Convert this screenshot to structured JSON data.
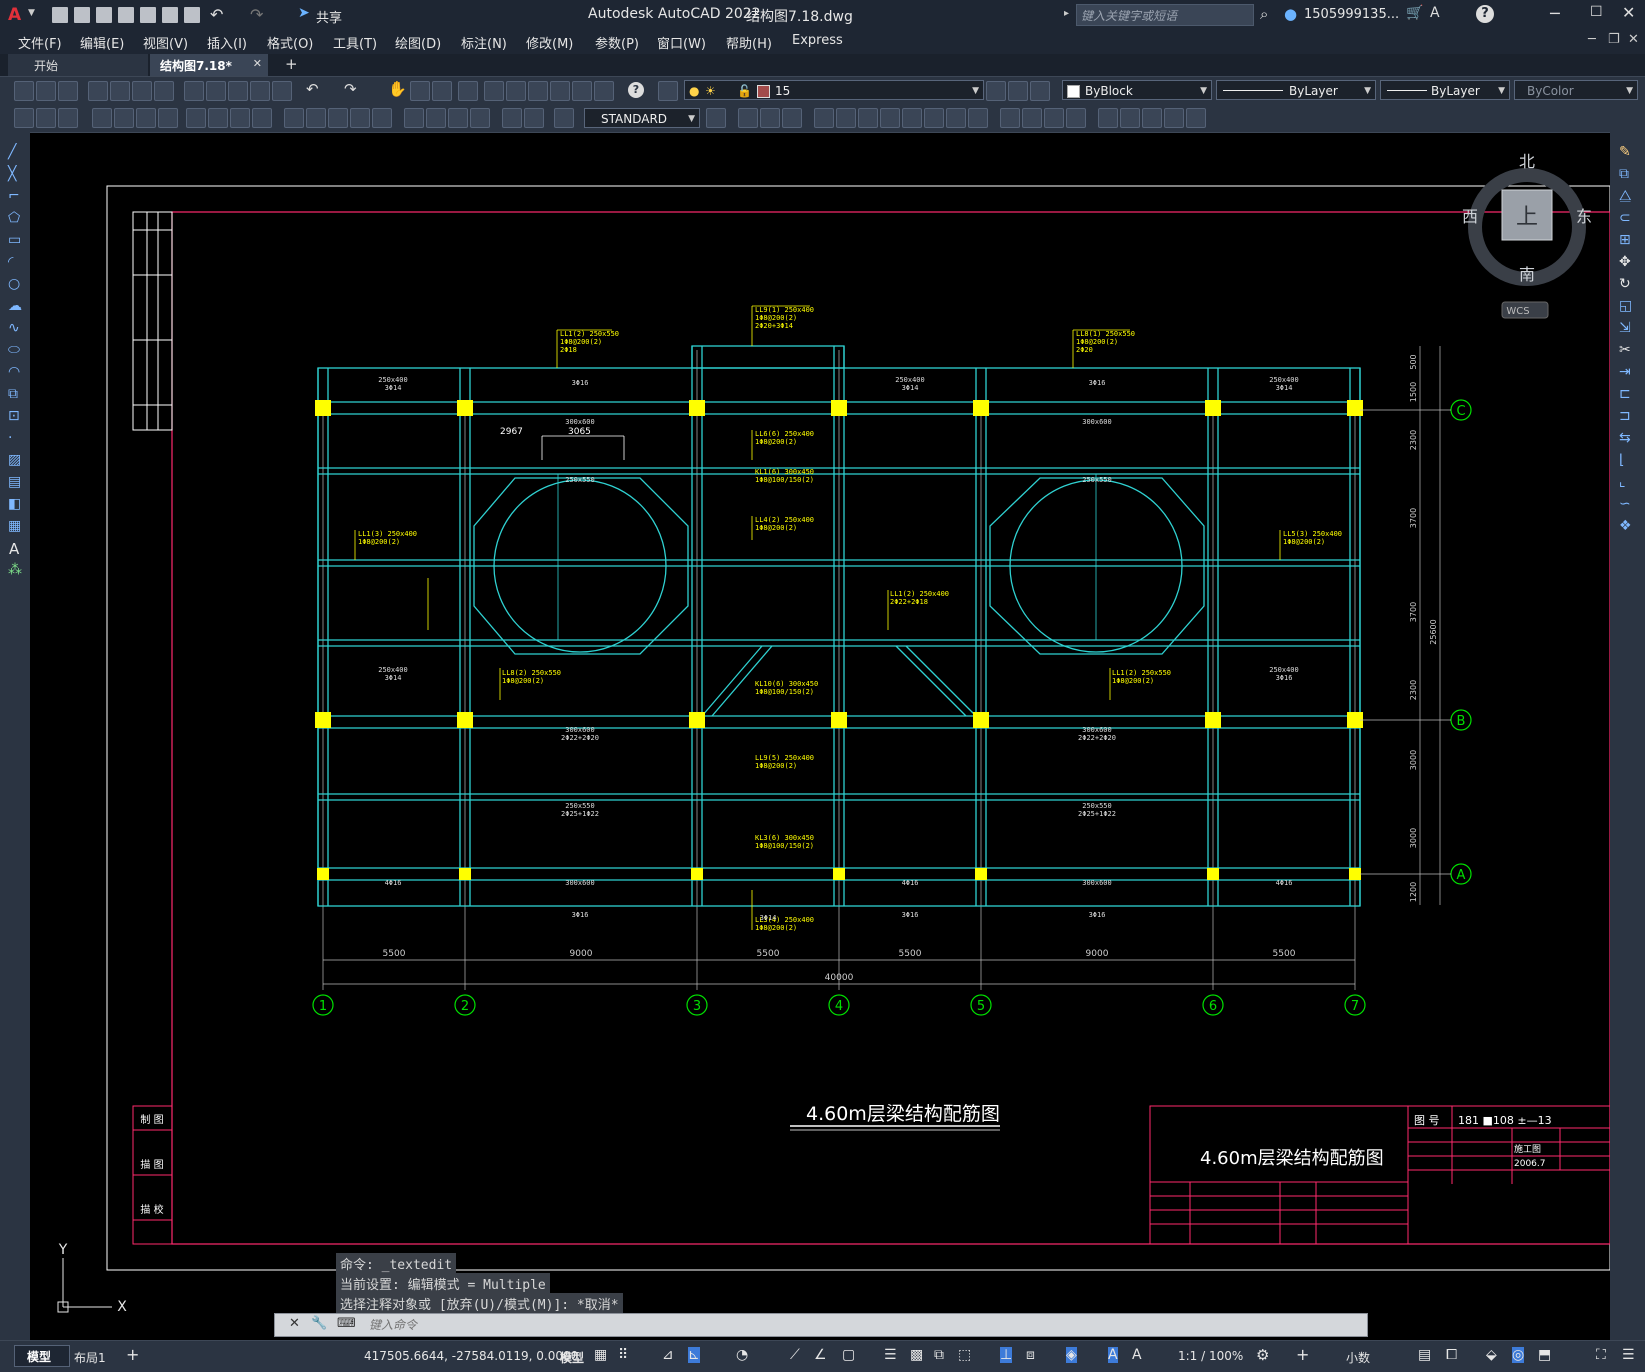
{
  "app": {
    "title": "Autodesk AutoCAD 2022",
    "file": "结构图7.18.dwg",
    "share": "共享",
    "search_placeholder": "键入关键字或短语",
    "user": "1505999135...",
    "logo": "A"
  },
  "menu": [
    "文件(F)",
    "编辑(E)",
    "视图(V)",
    "插入(I)",
    "格式(O)",
    "工具(T)",
    "绘图(D)",
    "标注(N)",
    "修改(M)",
    "参数(P)",
    "窗口(W)",
    "帮助(H)",
    "Express"
  ],
  "tabs": {
    "start": "开始",
    "active": "结构图7.18*",
    "close": "✕",
    "add": "+"
  },
  "toolbar": {
    "layer": "15",
    "textstyle": "STANDARD",
    "color": "ByBlock",
    "linetype": "ByLayer",
    "lineweight": "ByLayer",
    "plotstyle": "ByColor"
  },
  "viewcube": {
    "north": "北",
    "south": "南",
    "east": "东",
    "west": "西",
    "top": "上",
    "wcs": "WCS"
  },
  "drawing": {
    "title": "4.60m层梁结构配筋图",
    "titleblock_title": "4.60m层梁结构配筋图",
    "drawing_no_label": "图 号",
    "drawing_no": "181 ■108 ±—13",
    "date": "2006.7",
    "stage": "施工图",
    "left_labels": [
      "制 图",
      "描 图",
      "描 校"
    ],
    "axis_cols": [
      "1",
      "2",
      "3",
      "4",
      "5",
      "6",
      "7"
    ],
    "axis_rows": [
      "C",
      "B",
      "A"
    ],
    "spans": [
      "5500",
      "9000",
      "5500",
      "5500",
      "9000",
      "5500"
    ],
    "total_span": "40000",
    "right_dims": [
      "500",
      "1500",
      "2300",
      "3700",
      "3700",
      "2300",
      "3000",
      "3000",
      "1200"
    ],
    "right_total": "25600",
    "dim_2967": "2967",
    "dim_3065": "3065"
  },
  "command": {
    "history": [
      "命令: _textedit",
      "当前设置: 编辑模式 = Multiple",
      "选择注释对象或 [放弃(U)/模式(M)]: *取消*"
    ],
    "placeholder": "键入命令"
  },
  "ucs": {
    "x": "X",
    "y": "Y"
  },
  "status": {
    "model_tab": "模型",
    "layout_tab": "布局1",
    "coords": "417505.6644, -27584.0119, 0.0000",
    "mode": "模型",
    "scale": "1:1 / 100%",
    "units": "小数"
  },
  "colors": {
    "beam": "#2fd1d1",
    "annotation": "#ffff00",
    "grid": "#00e000",
    "frame": "#ff2a6d",
    "column": "#ffff00"
  }
}
